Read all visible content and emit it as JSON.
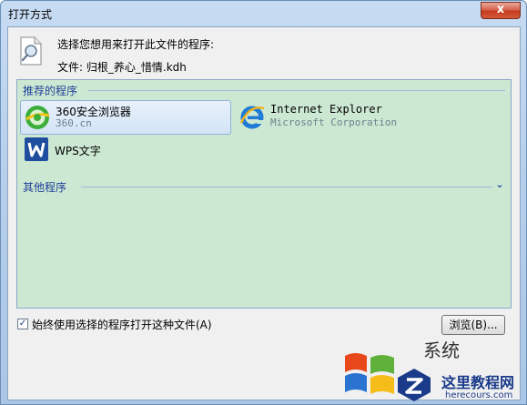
{
  "window": {
    "title": "打开方式",
    "close_label": "x"
  },
  "header": {
    "prompt": "选择您想用来打开此文件的程序:",
    "file_label": "文件:",
    "file_name": "归根_养心_惜情.kdh"
  },
  "groups": {
    "recommended": "推荐的程序",
    "other": "其他程序"
  },
  "apps": [
    {
      "name": "360安全浏览器",
      "subtitle": "360.cn",
      "icon": "360-browser-icon",
      "selected": true
    },
    {
      "name": "Internet Explorer",
      "subtitle": "Microsoft Corporation",
      "icon": "internet-explorer-icon",
      "selected": false
    },
    {
      "name": "WPS文字",
      "subtitle": "",
      "icon": "wps-writer-icon",
      "selected": false
    }
  ],
  "footer": {
    "always_use_label": "始终使用选择的程序打开这种文件(A)",
    "always_use_checked": true,
    "browse_label": "浏览(B)..."
  },
  "watermark": {
    "brand": "系统",
    "site": "这里教程网",
    "url": "herecours.com"
  },
  "colors": {
    "list_bg": "#cde8d2",
    "group_label": "#1e3f9a",
    "selection": "#d3e4f6"
  }
}
